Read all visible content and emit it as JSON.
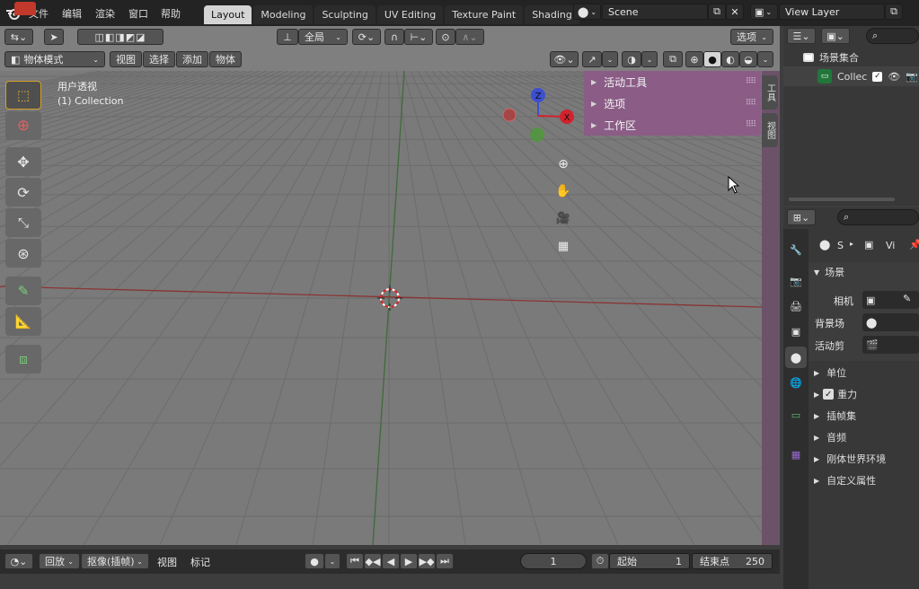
{
  "topbar": {
    "menus": [
      "文件",
      "编辑",
      "渲染",
      "窗口",
      "帮助"
    ],
    "workspaces": [
      "Layout",
      "Modeling",
      "Sculpting",
      "UV Editing",
      "Texture Paint",
      "Shading"
    ],
    "active_workspace": "Layout",
    "scene": "Scene",
    "view_layer": "View Layer"
  },
  "viewport_header": {
    "global": "全局",
    "options": "选项",
    "mode": "物体模式",
    "menus": [
      "视图",
      "选择",
      "添加",
      "物体"
    ]
  },
  "viewport": {
    "view_name": "用户透视",
    "collection": "(1) Collection",
    "gizmo": {
      "z": "Z",
      "x": "X"
    }
  },
  "sidebar": {
    "items": [
      "活动工具",
      "选项",
      "工作区"
    ],
    "tabs": [
      "工具",
      "视图"
    ]
  },
  "outliner": {
    "scene_collection": "场景集合",
    "collection": "Collec"
  },
  "properties": {
    "header_scene": "S",
    "header_view": "Vi",
    "section_scene": "场景",
    "camera_label": "相机",
    "background_label": "背景场",
    "active_clip_label": "活动剪",
    "sections": [
      "单位",
      "重力",
      "插帧集",
      "音频",
      "刚体世界环境",
      "自定义属性"
    ],
    "gravity_checked": true
  },
  "timeline": {
    "playback": "回放",
    "keying": "抠像(插帧)",
    "view": "视图",
    "marker": "标记",
    "current_frame": "1",
    "start_label": "起始",
    "start_value": "1",
    "end_label": "结束点",
    "end_value": "250"
  },
  "colors": {
    "accent": "#d4d4d4",
    "sidebar_panel": "#8d5b88",
    "x_axis": "#d2222d",
    "y_axis": "#4c9a38",
    "z_axis": "#3c4fd1"
  }
}
